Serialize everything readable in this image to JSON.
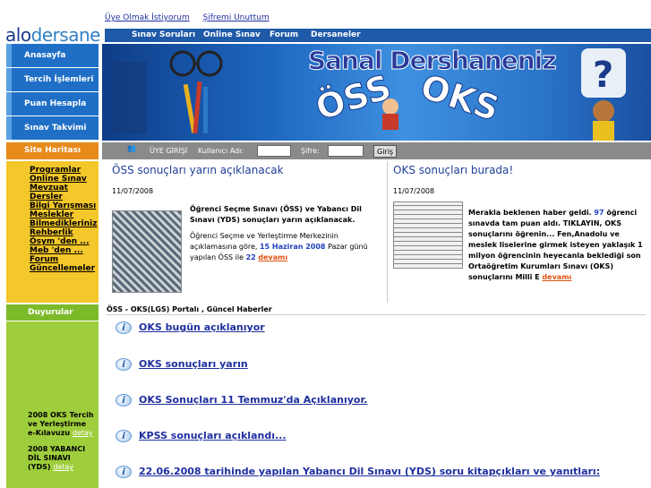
{
  "toplinks": {
    "register": "Üye Olmak İstiyorum",
    "forgot": "Şifremi Unuttum"
  },
  "logo": {
    "part1": "alo",
    "part2": "dersane"
  },
  "topnav": [
    "Sınav Soruları",
    "Online Sınav",
    "Forum",
    "Dersaneler"
  ],
  "sidebar": {
    "items": [
      "Anasayfa",
      "Tercih İşlemleri",
      "Puan Hesapla",
      "Sınav Takvimi"
    ]
  },
  "banner": {
    "title": "Sanal Dershaneniz",
    "oss": "ÖSS",
    "oks": "OKS"
  },
  "sitemap": {
    "label": "Site Haritası",
    "links": [
      "Programlar",
      "Online Sınav",
      "Mevzuat",
      "Dersler",
      "Bilgi Yarışması",
      "Meslekler",
      "Bilmedikleriniz",
      "Rehberlik",
      "Ösym 'den ...",
      "Meb 'den ...",
      "Forum",
      "Güncellemeler"
    ]
  },
  "login": {
    "title": "ÜYE GİRİŞİ",
    "user_label": "Kullanıcı Adı:",
    "pass_label": "Şifre:",
    "button": "Giriş"
  },
  "news": [
    {
      "title": "ÖSS sonuçları yarın açıklanacak",
      "date": "11/07/2008",
      "lead": "Öğrenci Seçme Sınavı (ÖSS) ve Yabancı Dil Sınavı (YDS) sonuçları yarın açıklanacak.",
      "body1": "Öğrenci Seçme ve Yerleştirme Merkezinin açıklamasına göre,",
      "hl": "15 Haziran 2008",
      "body2": "Pazar günü yapılan ÖSS ile",
      "num": "22",
      "more": "devamı"
    },
    {
      "title": "OKS sonuçları burada!",
      "date": "11/07/2008",
      "body1": "Merakla beklenen haber geldi.",
      "num": "97",
      "body2": "öğrenci sınavda tam puan aldı. TIKLAYIN, OKS sonuçlarını öğrenin... Fen,Anadolu ve meslek liselerine girmek isteyen yaklaşık 1 milyon öğrencinin heyecanla beklediği son Ortaöğretim Kurumları Sınavı (OKS) sonuçlarını Milli E",
      "more": "devamı"
    }
  ],
  "duyurular": {
    "label": "Duyurular",
    "items": [
      {
        "text": "2008 OKS Tercih ve Yerleştirme e-Kılavuzu",
        "more": "detay"
      },
      {
        "text": "2008 YABANCI DİL SINAVI (YDS)",
        "more": "detay"
      }
    ]
  },
  "section": {
    "title": "ÖSS - OKS(LGS) Portalı , Güncel Haberler"
  },
  "headlines": [
    "OKS bugün açıklanıyor",
    "OKS sonuçları yarın",
    "OKS Sonuçları 11 Temmuz'da Açıklanıyor.",
    "KPSS sonuçları açıklandı...",
    "22.06.2008 tarihinde yapılan Yabancı Dil Sınavı (YDS) soru kitapçıkları ve yanıtları:"
  ]
}
